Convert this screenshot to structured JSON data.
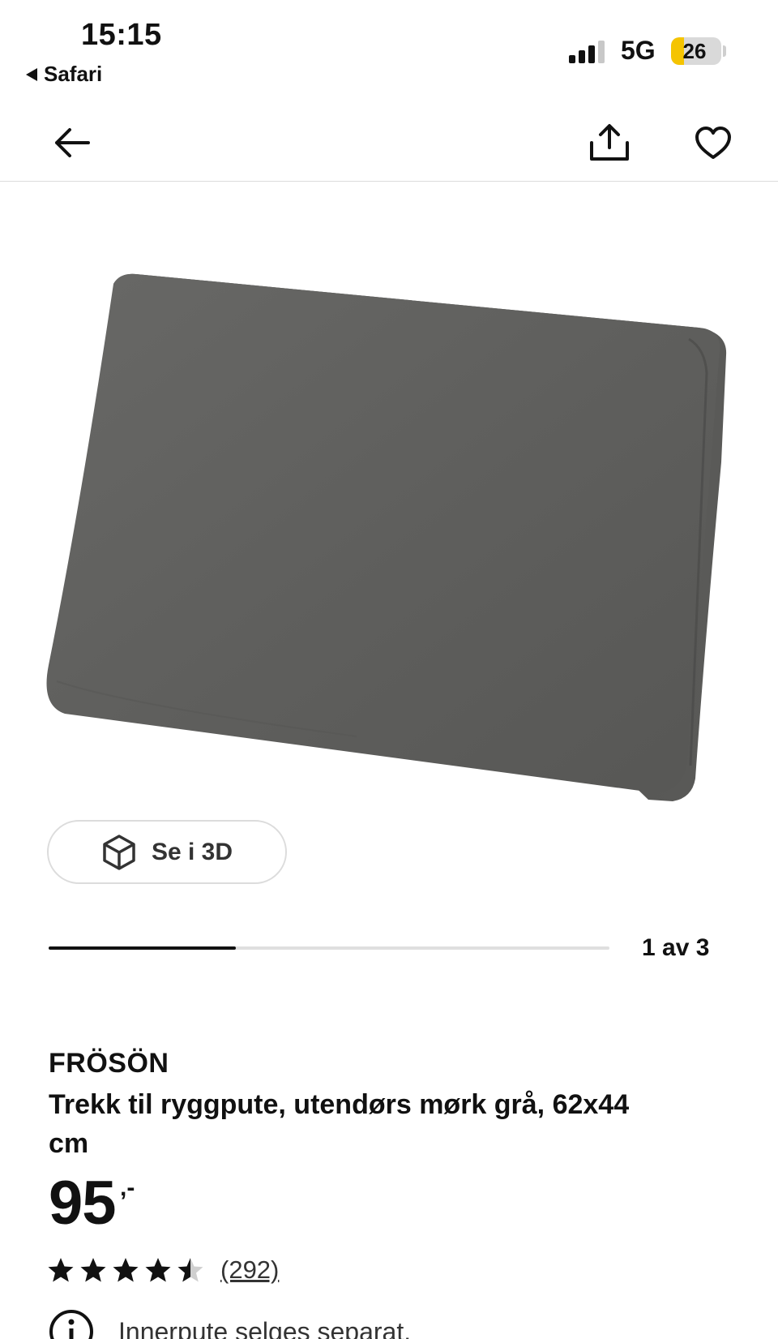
{
  "status_bar": {
    "time": "15:15",
    "back_app": "Safari",
    "network": "5G",
    "battery_level": "26",
    "battery_fraction": 0.26,
    "battery_color": "#f5c400"
  },
  "header": {
    "back_icon": "arrow-left-icon",
    "share_icon": "share-icon",
    "favorite_icon": "heart-outline-icon"
  },
  "gallery": {
    "image_description_color": "#5e5e5c",
    "view_3d_label": "Se i 3D",
    "view_3d_icon": "cube-icon",
    "carousel_counter": "1 av 3",
    "carousel_progress": 0.3333
  },
  "product": {
    "brand": "FRÖSÖN",
    "description": "Trekk til ryggpute, utendørs mørk grå, 62x44 cm",
    "price": "95",
    "price_suffix": ",-",
    "rating": 4.5,
    "rating_max": 5,
    "review_count": "(292)",
    "info_icon": "info-icon",
    "info_text": "Innerpute selges separat."
  }
}
